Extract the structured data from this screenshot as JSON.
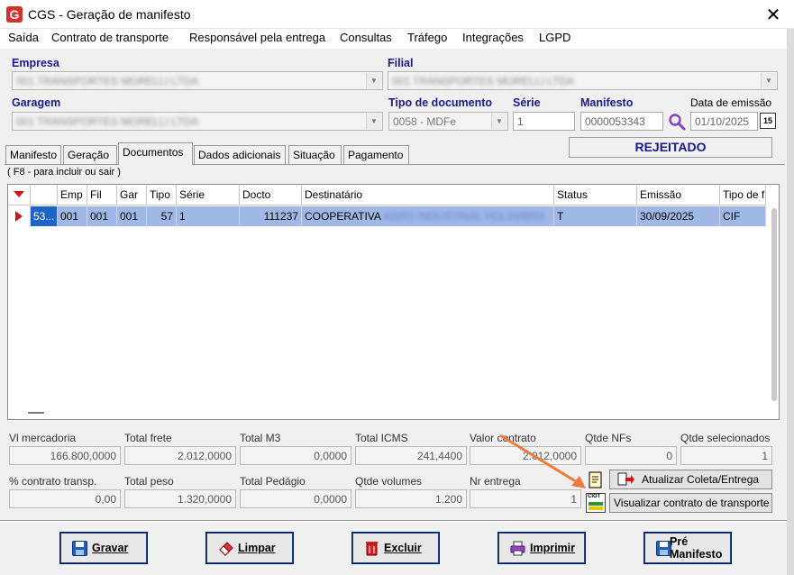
{
  "window": {
    "title": "CGS - Geração de manifesto",
    "close": "✕",
    "app_icon": "G"
  },
  "menu": [
    "Saída",
    "Contrato de transporte",
    "Responsável pela entrega",
    "Consultas",
    "Tráfego",
    "Integrações",
    "LGPD"
  ],
  "header": {
    "empresa_label": "Empresa",
    "empresa_value": "001 TRANSPORTES MORELLI LTDA",
    "filial_label": "Filial",
    "filial_value": "001 TRANSPORTES MORELLI LTDA",
    "garagem_label": "Garagem",
    "garagem_value": "001 TRANSPORTES MORELLI LTDA",
    "tipo_doc_label": "Tipo de documento",
    "tipo_doc_value": "0058 - MDFe",
    "serie_label": "Série",
    "serie_value": "1",
    "manifesto_label": "Manifesto",
    "manifesto_value": "0000053343",
    "data_label": "Data de emissão",
    "data_value": "01/10/2025",
    "calendar_label": "15",
    "status": "REJEITADO"
  },
  "tabs": [
    "Manifesto",
    "Geração",
    "Documentos",
    "Dados adicionais",
    "Situação",
    "Pagamento"
  ],
  "hint": "( F8 - para incluir ou sair )",
  "grid": {
    "columns": [
      "",
      "Emp",
      "Fil",
      "Gar",
      "Tipo",
      "Série",
      "Docto",
      "Destinatário",
      "Status",
      "Emissão",
      "Tipo de f"
    ],
    "row": {
      "id": "53...",
      "emp": "001",
      "fil": "001",
      "gar": "001",
      "tipo": "57",
      "serie": "1",
      "docto": "111237",
      "destinatario": "COOPERATIVA",
      "destinatario_hidden": "AGRO INDUSTRIAL HOLAMBRA",
      "status": "T",
      "emissao": "30/09/2025",
      "tipo_frete": "CIF"
    }
  },
  "totals": {
    "vl_mercadoria_label": "Vl mercadoria",
    "vl_mercadoria": "166.800,0000",
    "total_frete_label": "Total frete",
    "total_frete": "2.012,0000",
    "total_m3_label": "Total M3",
    "total_m3": "0,0000",
    "total_icms_label": "Total ICMS",
    "total_icms": "241,4400",
    "valor_contrato_label": "Valor contrato",
    "valor_contrato": "2.012,0000",
    "qtde_nfs_label": "Qtde NFs",
    "qtde_nfs": "0",
    "qtde_sel_label": "Qtde selecionados",
    "qtde_sel": "1",
    "pct_contrato_label": "% contrato transp.",
    "pct_contrato": "0,00",
    "total_peso_label": "Total peso",
    "total_peso": "1.320,0000",
    "total_pedagio_label": "Total Pedágio",
    "total_pedagio": "0,0000",
    "qtde_volumes_label": "Qtde volumes",
    "qtde_volumes": "1.200",
    "nr_entrega_label": "Nr entrega",
    "nr_entrega": "1"
  },
  "actions": {
    "atualizar": "Atualizar Coleta/Entrega",
    "visualizar": "Visualizar contrato de transporte",
    "ciot_label": "CIOT"
  },
  "buttons": {
    "gravar": "Gravar",
    "limpar": "Limpar",
    "excluir": "Excluir",
    "imprimir": "Imprimir",
    "pre_manifesto_1": "Pré",
    "pre_manifesto_2": "Manifesto"
  },
  "colors": {
    "accent": "#1a1a8c",
    "selection": "#9fb8e6",
    "annotation_arrow": "#f07a3c"
  }
}
